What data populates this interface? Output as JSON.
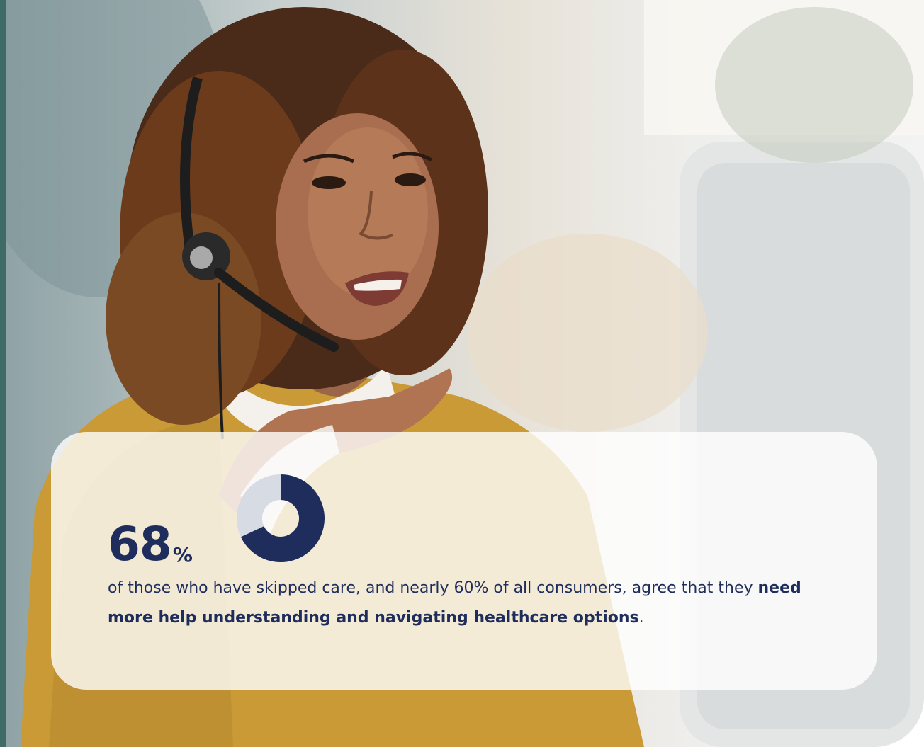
{
  "stat": {
    "value": "68",
    "unit": "%",
    "fraction": 0.68
  },
  "caption": {
    "part1": "of those who have skipped care, and nearly 60% of all consumers, agree that they ",
    "emphasis": "need more help understanding and navigating healthcare options",
    "part2": "."
  },
  "colors": {
    "navy": "#1f2d5c",
    "donut_track": "#d7dbe4",
    "side_accent": "#3f6b66",
    "sweater": "#c99a36"
  },
  "photo": {
    "subject": "woman-with-headset-photo"
  }
}
